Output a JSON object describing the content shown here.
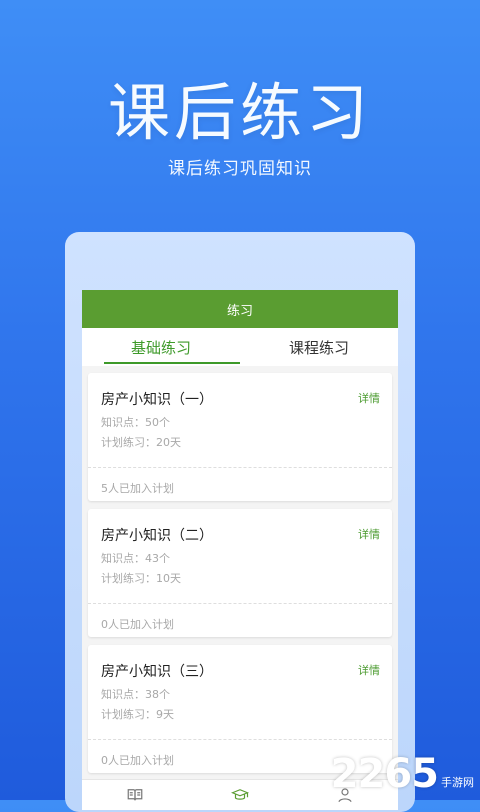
{
  "hero": {
    "title": "课后练习",
    "subtitle": "课后练习巩固知识"
  },
  "app": {
    "header_title": "练习",
    "tabs": [
      {
        "label": "基础练习",
        "active": true
      },
      {
        "label": "课程练习",
        "active": false
      }
    ],
    "cards": [
      {
        "title": "房产小知识（一）",
        "detail": "详情",
        "points": "知识点：50个",
        "plan": "计划练习：20天",
        "footer": "5人已加入计划"
      },
      {
        "title": "房产小知识（二）",
        "detail": "详情",
        "points": "知识点：43个",
        "plan": "计划练习：10天",
        "footer": "0人已加入计划"
      },
      {
        "title": "房产小知识（三）",
        "detail": "详情",
        "points": "知识点：38个",
        "plan": "计划练习：9天",
        "footer": "0人已加入计划"
      }
    ],
    "bottom_nav": [
      {
        "icon": "book-icon"
      },
      {
        "icon": "graduation-cap-icon"
      },
      {
        "icon": "user-icon"
      }
    ],
    "colors": {
      "accent_green": "#5a9d31",
      "background_blue": "#2f74ec"
    }
  },
  "watermark": {
    "number": "2265",
    "text": "手游网"
  }
}
